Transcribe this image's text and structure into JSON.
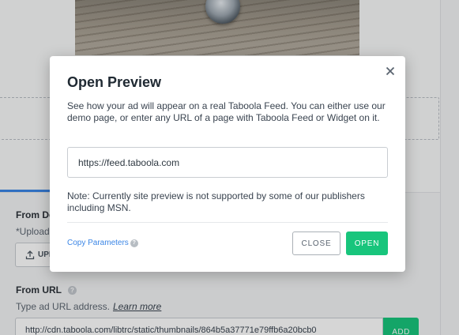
{
  "background": {
    "from_device_title": "From De",
    "upload_note": "*Upload",
    "upload_button_label": "UPL",
    "from_url_title": "From URL",
    "url_hint": "Type ad URL address.",
    "learn_more": "Learn more",
    "url_value": "http://cdn.taboola.com/libtrc/static/thumbnails/864b5a37771e79ffb6a20bcb0",
    "add_label": "ADD"
  },
  "modal": {
    "title": "Open Preview",
    "description": "See how your ad will appear on a real Taboola Feed. You can either use our demo page, or enter any URL of a page with Taboola Feed or Widget on it.",
    "url_value": "https://feed.taboola.com",
    "note": "Note: Currently site preview is not supported by some of our publishers including MSN.",
    "copy_parameters": "Copy Parameters",
    "close_label": "CLOSE",
    "open_label": "OPEN"
  },
  "icons": {
    "close": "close-icon",
    "help": "help-circle-icon",
    "upload": "upload-icon"
  },
  "colors": {
    "accent_green": "#18c57c",
    "link_blue": "#3b86e6"
  }
}
